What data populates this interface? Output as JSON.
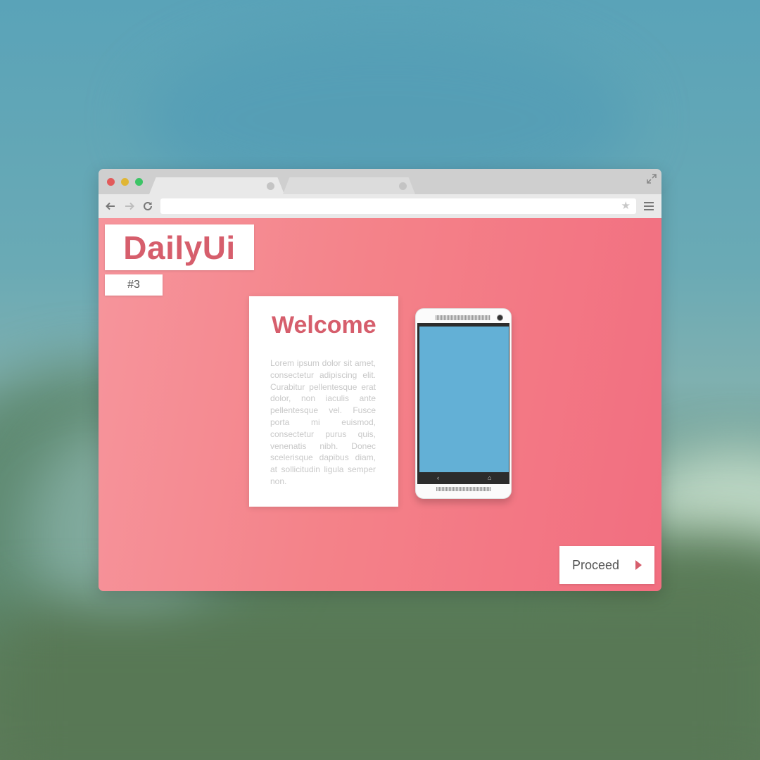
{
  "colors": {
    "accent": "#d65e6c",
    "viewport_gradient_start": "#f6959c",
    "viewport_gradient_end": "#f26e80",
    "phone_screen": "#63b0d6",
    "traffic_red": "#e25a5a",
    "traffic_yellow": "#e0b635",
    "traffic_green": "#3cc466"
  },
  "browser": {
    "tabs": [
      {
        "label": "",
        "active": true
      },
      {
        "label": "",
        "active": false
      }
    ],
    "address_value": "",
    "icons": [
      "back-arrow-icon",
      "forward-arrow-icon",
      "reload-icon",
      "star-icon",
      "menu-icon",
      "fullscreen-icon"
    ]
  },
  "page": {
    "brand": "DailyUi",
    "issue": "#3",
    "card": {
      "title": "Welcome",
      "body": "Lorem ipsum dolor sit amet, consectetur adipiscing elit. Curabitur pellentesque erat dolor, non iaculis ante pellentesque vel. Fusce porta mi euismod, consectetur purus quis, venenatis nibh. Donec scelerisque dapibus diam, at sollicitudin ligula semper non."
    },
    "phone": {
      "back_key": "‹",
      "home_key": "⌂"
    },
    "proceed_label": "Proceed"
  }
}
